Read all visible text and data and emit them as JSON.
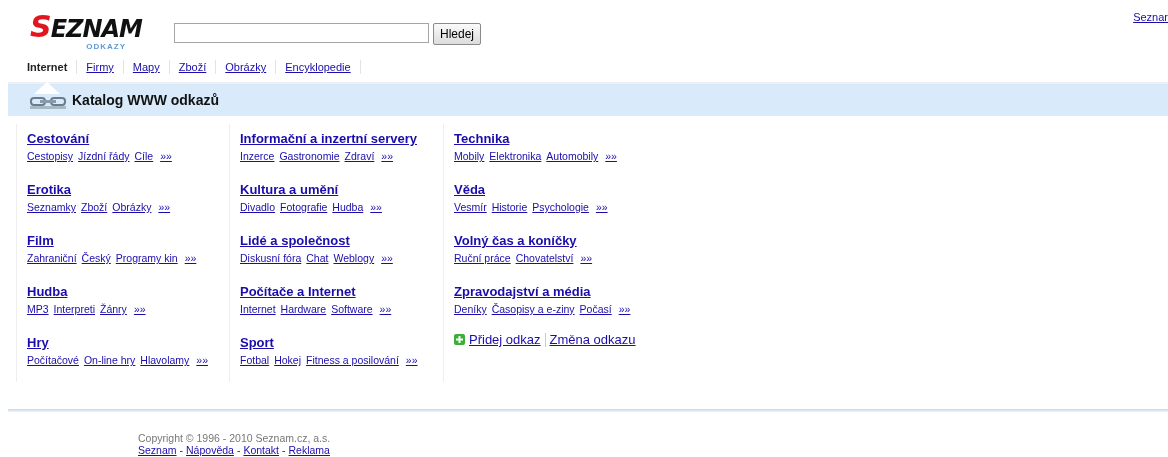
{
  "logo": {
    "text": "SEZNAM",
    "subtitle": "ODKAZY"
  },
  "search": {
    "button": "Hledej"
  },
  "top_link": "Seznar",
  "tabs": [
    {
      "label": "Internet",
      "selected": true
    },
    {
      "label": "Firmy",
      "selected": false
    },
    {
      "label": "Mapy",
      "selected": false
    },
    {
      "label": "Zboží",
      "selected": false
    },
    {
      "label": "Obrázky",
      "selected": false
    },
    {
      "label": "Encyklopedie",
      "selected": false
    }
  ],
  "heading": "Katalog WWW odkazů",
  "columns": [
    {
      "categories": [
        {
          "title": "Cestování",
          "links": [
            "Cestopisy",
            "Jízdní řády",
            "Cíle"
          ],
          "more": "»»"
        },
        {
          "title": "Erotika",
          "links": [
            "Seznamky",
            "Zboží",
            "Obrázky"
          ],
          "more": "»»"
        },
        {
          "title": "Film",
          "links": [
            "Zahraniční",
            "Český",
            "Programy kin"
          ],
          "more": "»»"
        },
        {
          "title": "Hudba",
          "links": [
            "MP3",
            "Interpreti",
            "Žánry"
          ],
          "more": "»»"
        },
        {
          "title": "Hry",
          "links": [
            "Počítačové",
            "On-line hry",
            "Hlavolamy"
          ],
          "more": "»»"
        }
      ]
    },
    {
      "categories": [
        {
          "title": "Informační a inzertní servery",
          "links": [
            "Inzerce",
            "Gastronomie",
            "Zdraví"
          ],
          "more": "»»"
        },
        {
          "title": "Kultura a umění",
          "links": [
            "Divadlo",
            "Fotografie",
            "Hudba"
          ],
          "more": "»»"
        },
        {
          "title": "Lidé a společnost",
          "links": [
            "Diskusní fóra",
            "Chat",
            "Weblogy"
          ],
          "more": "»»"
        },
        {
          "title": "Počítače a Internet",
          "links": [
            "Internet",
            "Hardware",
            "Software"
          ],
          "more": "»»"
        },
        {
          "title": "Sport",
          "links": [
            "Fotbal",
            "Hokej",
            "Fitness a posilování"
          ],
          "more": "»»"
        }
      ]
    },
    {
      "categories": [
        {
          "title": "Technika",
          "links": [
            "Mobily",
            "Elektronika",
            "Automobily"
          ],
          "more": "»»"
        },
        {
          "title": "Věda",
          "links": [
            "Vesmír",
            "Historie",
            "Psychologie"
          ],
          "more": "»»"
        },
        {
          "title": "Volný čas a koníčky",
          "links": [
            "Ruční práce",
            "Chovatelství"
          ],
          "more": "»»"
        },
        {
          "title": "Zpravodajství a média",
          "links": [
            "Deníky",
            "Časopisy a e-ziny",
            "Počasí"
          ],
          "more": "»»"
        }
      ],
      "actions": [
        "Přidej odkaz",
        "Změna odkazu"
      ]
    }
  ],
  "footer": {
    "copyright": "Copyright © 1996 - 2010 Seznam.cz, a.s.",
    "items": [
      {
        "kind": "link",
        "text": "Seznam"
      },
      {
        "kind": "sep",
        "text": "-"
      },
      {
        "kind": "link",
        "text": "Nápověda"
      },
      {
        "kind": "sep",
        "text": "-"
      },
      {
        "kind": "link",
        "text": "Kontakt"
      },
      {
        "kind": "sep",
        "text": "-"
      },
      {
        "kind": "link",
        "text": "Reklama"
      }
    ]
  }
}
